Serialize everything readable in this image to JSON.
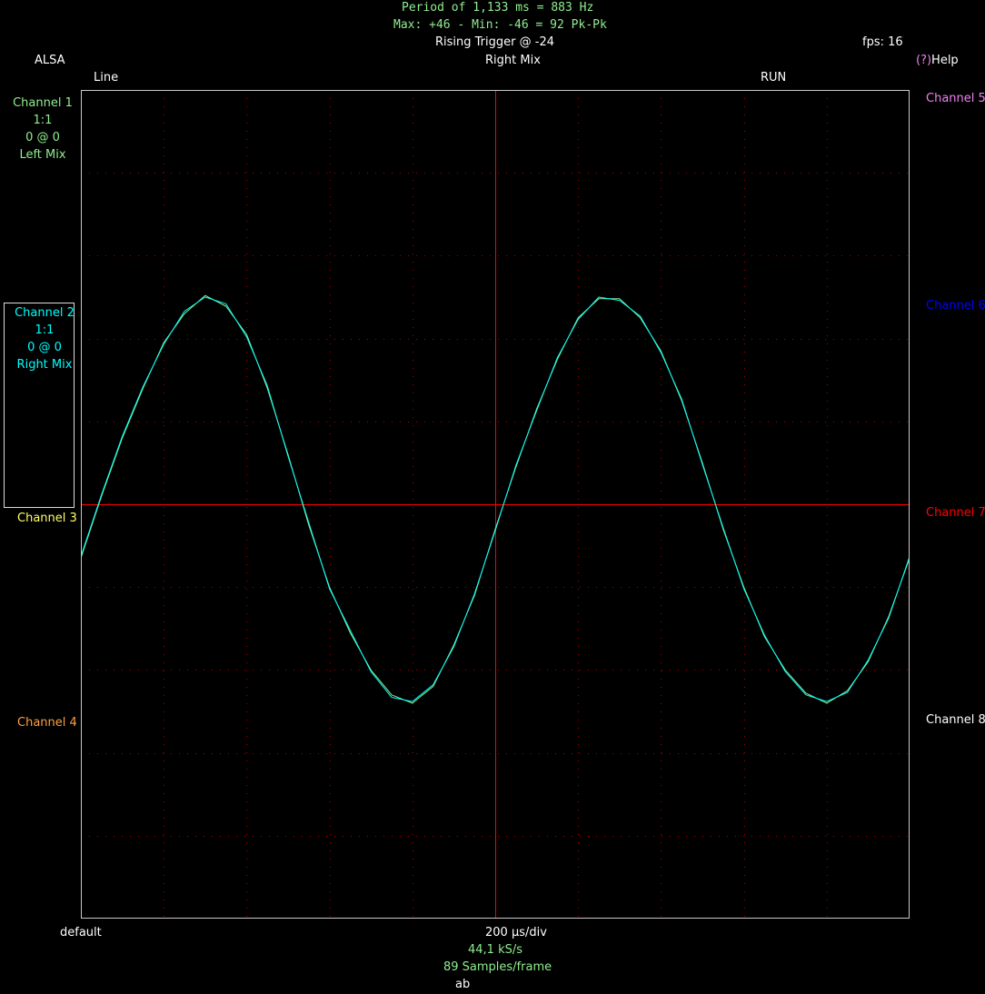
{
  "header": {
    "period_line": "Period of 1,133 ms =   883 Hz",
    "maxmin_line": "Max: +46 - Min: -46 =  92 Pk-Pk",
    "trigger": "Rising Trigger @ -24",
    "fps": "fps: 16",
    "source": "ALSA",
    "trigger_channel": "Right Mix",
    "help_key": "(?)",
    "help_label": "Help",
    "line_label": "Line",
    "run_status": "RUN"
  },
  "channels_left": [
    {
      "name": "Channel 1",
      "scale": "1:1",
      "offset": "0 @ 0",
      "source": "Left Mix",
      "color": "#90ee90"
    },
    {
      "name": "Channel 2",
      "scale": "1:1",
      "offset": "0 @ 0",
      "source": "Right Mix",
      "color": "#00ffff"
    },
    {
      "name": "Channel 3",
      "color": "#ffff66"
    },
    {
      "name": "Channel 4",
      "color": "#ffa040"
    }
  ],
  "channels_right": [
    {
      "name": "Channel 5",
      "color": "#ee82ee"
    },
    {
      "name": "Channel 6",
      "color": "#0000ff"
    },
    {
      "name": "Channel 7",
      "color": "#ff0000"
    },
    {
      "name": "Channel 8",
      "color": "#ffffff"
    }
  ],
  "footer": {
    "preset": "default",
    "timebase": "200 µs/div",
    "sample_rate": "44,1 kS/s",
    "samples": "89 Samples/frame",
    "mode": "ab"
  },
  "colors": {
    "text_green": "#90ee90",
    "grid": "#b00000",
    "cursor": "#ff0000",
    "frame": "#c8c8c8"
  },
  "chart_data": {
    "type": "line",
    "title": "",
    "xlabel": "200 µs/div",
    "ylabel": "",
    "x_divisions": 10,
    "y_divisions": 10,
    "xlim": [
      0,
      10
    ],
    "ylim": [
      -5,
      5
    ],
    "grid": true,
    "series": [
      {
        "name": "Channel 1",
        "color": "#90ee90",
        "x": [
          0,
          0.25,
          0.5,
          0.75,
          1,
          1.25,
          1.5,
          1.75,
          2,
          2.25,
          2.5,
          2.75,
          3,
          3.25,
          3.5,
          3.75,
          4,
          4.25,
          4.5,
          4.75,
          5,
          5.25,
          5.5,
          5.75,
          6,
          6.25,
          6.5,
          6.75,
          7,
          7.25,
          7.5,
          7.75,
          8,
          8.25,
          8.5,
          8.75,
          9,
          9.25,
          9.5,
          9.75,
          10
        ],
        "values": [
          -0.65,
          0.1,
          0.8,
          1.4,
          1.95,
          2.3,
          2.52,
          2.39,
          2.05,
          1.4,
          0.6,
          -0.25,
          -1.0,
          -1.55,
          -2.0,
          -2.3,
          -2.4,
          -2.2,
          -1.7,
          -1.1,
          -0.3,
          0.45,
          1.15,
          1.75,
          2.25,
          2.48,
          2.48,
          2.25,
          1.85,
          1.25,
          0.5,
          -0.3,
          -1.0,
          -1.6,
          -2.0,
          -2.28,
          -2.4,
          -2.25,
          -1.9,
          -1.35,
          -0.65
        ]
      },
      {
        "name": "Channel 2",
        "color": "#00ffff",
        "x": [
          0,
          0.25,
          0.5,
          0.75,
          1,
          1.25,
          1.5,
          1.75,
          2,
          2.25,
          2.5,
          2.75,
          3,
          3.25,
          3.5,
          3.75,
          4,
          4.25,
          4.5,
          4.75,
          5,
          5.25,
          5.5,
          5.75,
          6,
          6.25,
          6.5,
          6.75,
          7,
          7.25,
          7.5,
          7.75,
          8,
          8.25,
          8.5,
          8.75,
          9,
          9.25,
          9.5,
          9.75,
          10
        ],
        "values": [
          -0.63,
          0.12,
          0.82,
          1.42,
          1.93,
          2.33,
          2.5,
          2.42,
          2.02,
          1.43,
          0.58,
          -0.22,
          -1.02,
          -1.52,
          -2.02,
          -2.33,
          -2.38,
          -2.18,
          -1.72,
          -1.08,
          -0.32,
          0.47,
          1.13,
          1.77,
          2.23,
          2.5,
          2.46,
          2.27,
          1.83,
          1.27,
          0.48,
          -0.28,
          -1.02,
          -1.58,
          -2.02,
          -2.3,
          -2.38,
          -2.27,
          -1.88,
          -1.37,
          -0.63
        ]
      }
    ],
    "cursors": {
      "vertical_division": 5,
      "horizontal_value": 0,
      "color": "#ff0000"
    }
  }
}
